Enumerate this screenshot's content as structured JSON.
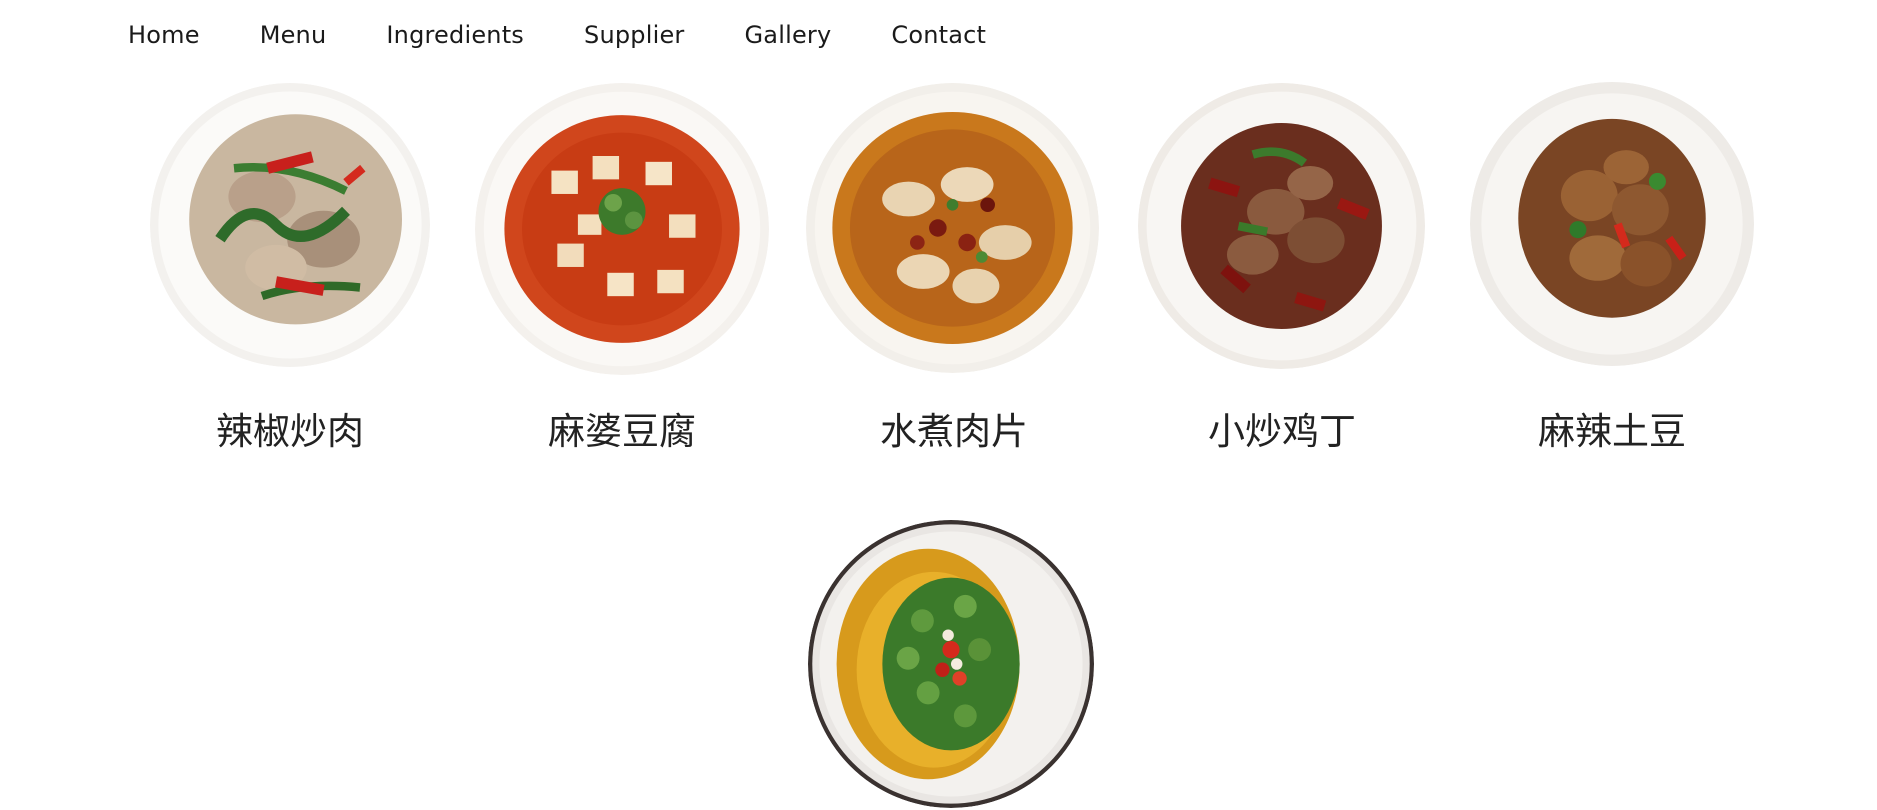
{
  "nav": {
    "items": [
      {
        "label": "Home"
      },
      {
        "label": "Menu"
      },
      {
        "label": "Ingredients"
      },
      {
        "label": "Supplier"
      },
      {
        "label": "Gallery"
      },
      {
        "label": "Contact"
      }
    ]
  },
  "dishes": [
    {
      "name": "辣椒炒肉",
      "image": "dish-photo-pepper-pork"
    },
    {
      "name": "麻婆豆腐",
      "image": "dish-photo-mapo-tofu"
    },
    {
      "name": "水煮肉片",
      "image": "dish-photo-boiled-pork"
    },
    {
      "name": "小炒鸡丁",
      "image": "dish-photo-chicken-dice"
    },
    {
      "name": "麻辣土豆",
      "image": "dish-photo-spicy-potato"
    },
    {
      "name": "",
      "image": "dish-photo-okra"
    }
  ]
}
